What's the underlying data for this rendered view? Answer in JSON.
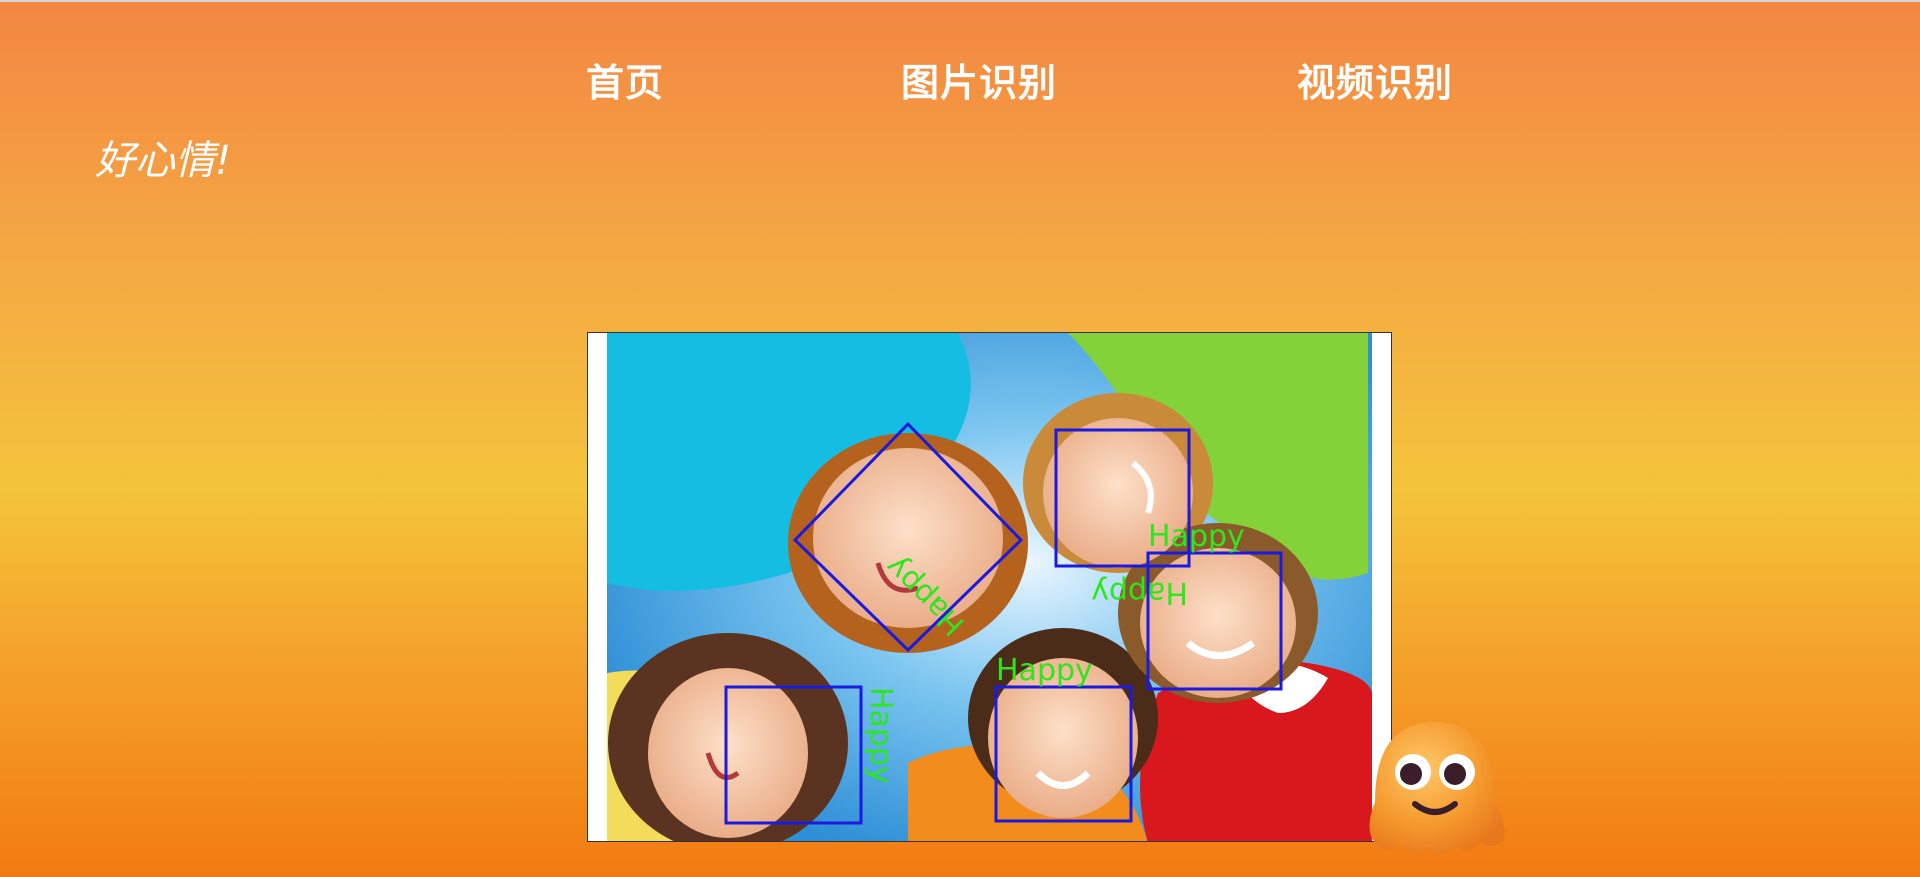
{
  "nav": {
    "home": "首页",
    "image_recognition": "图片识别",
    "video_recognition": "视频识别"
  },
  "mood": {
    "text": "好心情!"
  },
  "result_image": {
    "face_labels": [
      "Happy",
      "Happy",
      "Happy",
      "Happy",
      "Happy"
    ],
    "box_color": "#1a1ae0",
    "label_color": "#2ee61e"
  },
  "mascot": {
    "icon": "octopus-mascot-icon"
  }
}
